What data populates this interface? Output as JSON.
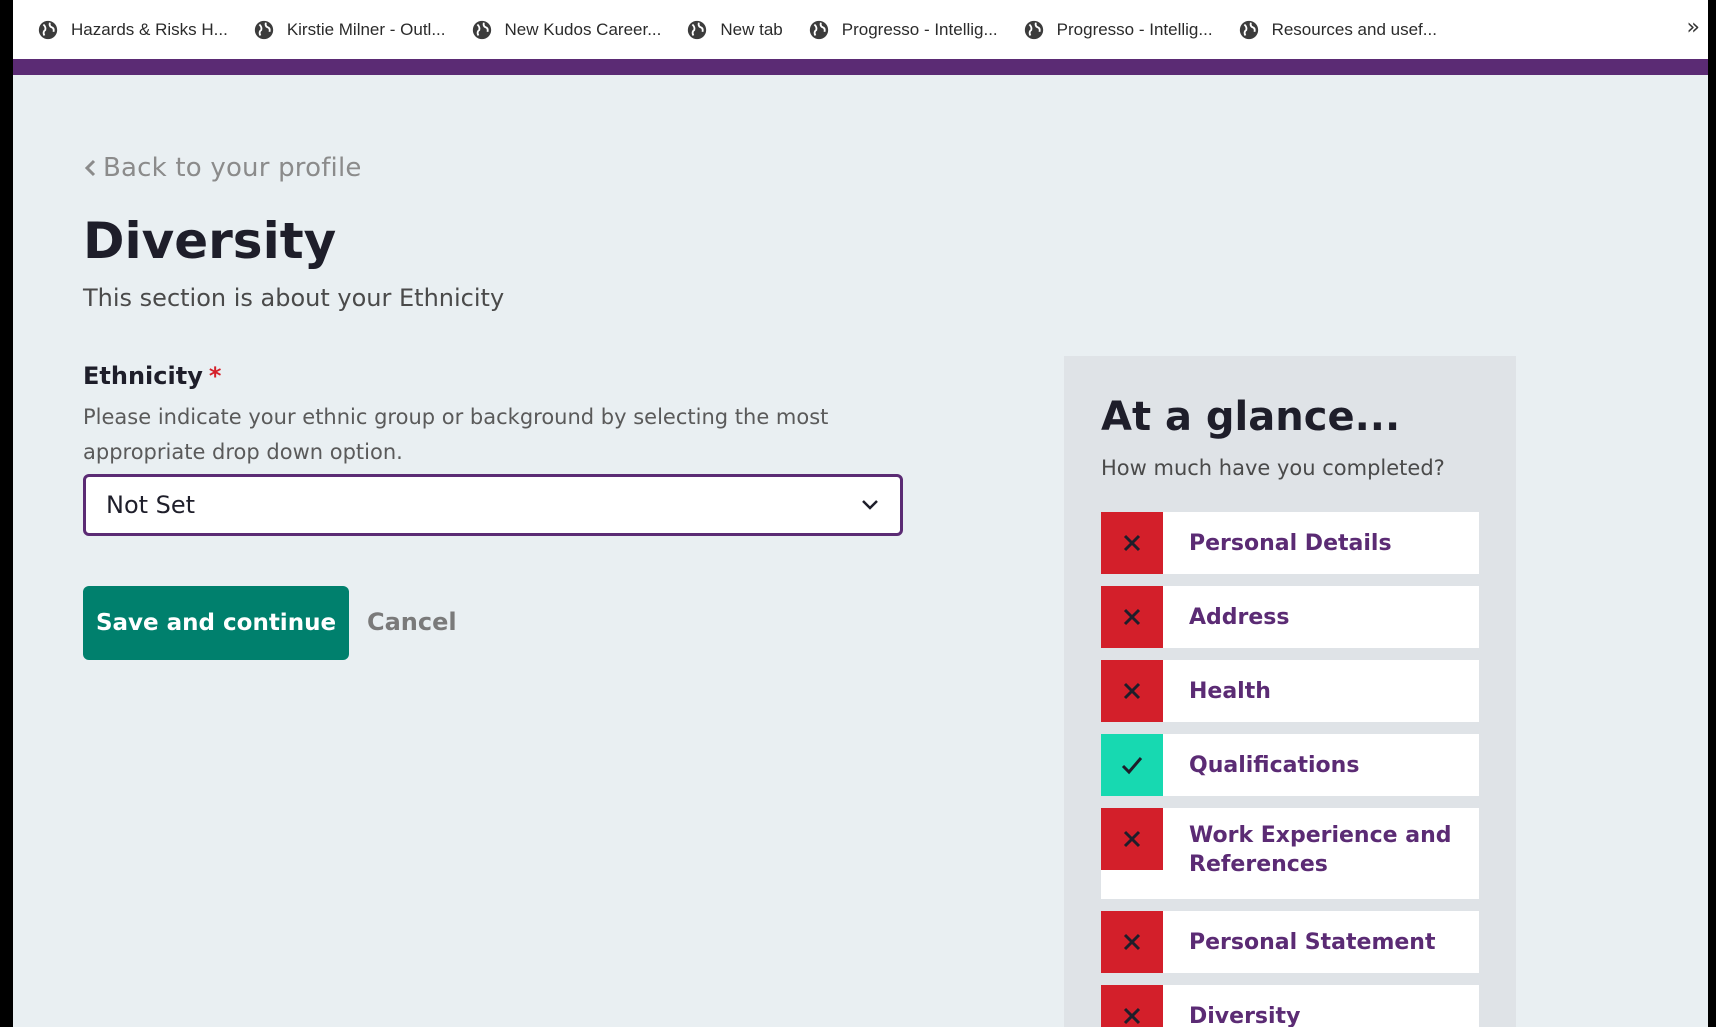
{
  "bookmarks": [
    {
      "label": "Hazards & Risks  H...",
      "icon": "globe-icon"
    },
    {
      "label": "Kirstie Milner - Outl...",
      "icon": "globe-icon"
    },
    {
      "label": "New Kudos Career...",
      "icon": "globe-icon"
    },
    {
      "label": "New tab",
      "icon": "globe-icon"
    },
    {
      "label": "Progresso - Intellig...",
      "icon": "globe-icon"
    },
    {
      "label": "Progresso - Intellig...",
      "icon": "globe-icon"
    },
    {
      "label": "Resources and usef...",
      "icon": "globe-icon"
    }
  ],
  "bookmarks_more": "»",
  "back_link": "Back to your profile",
  "page": {
    "title": "Diversity",
    "subtitle": "This section is about your Ethnicity"
  },
  "field": {
    "label": "Ethnicity",
    "required_mark": "*",
    "help": "Please indicate your ethnic group or background by selecting the most appropriate drop down option.",
    "selected_value": "Not Set"
  },
  "actions": {
    "save_label": "Save and continue",
    "cancel_label": "Cancel"
  },
  "glance": {
    "title": "At a glance...",
    "subtitle": "How much have you completed?",
    "items": [
      {
        "label": "Personal Details",
        "status": "incomplete"
      },
      {
        "label": "Address",
        "status": "incomplete"
      },
      {
        "label": "Health",
        "status": "incomplete"
      },
      {
        "label": "Qualifications",
        "status": "complete"
      },
      {
        "label": "Work Experience and References",
        "status": "incomplete"
      },
      {
        "label": "Personal Statement",
        "status": "incomplete"
      },
      {
        "label": "Diversity",
        "status": "incomplete"
      }
    ]
  },
  "colors": {
    "brand_purple": "#5b2b74",
    "primary_button": "#00806d",
    "incomplete": "#d31f2a",
    "complete": "#17d9b1",
    "page_bg": "#e9eff2"
  }
}
